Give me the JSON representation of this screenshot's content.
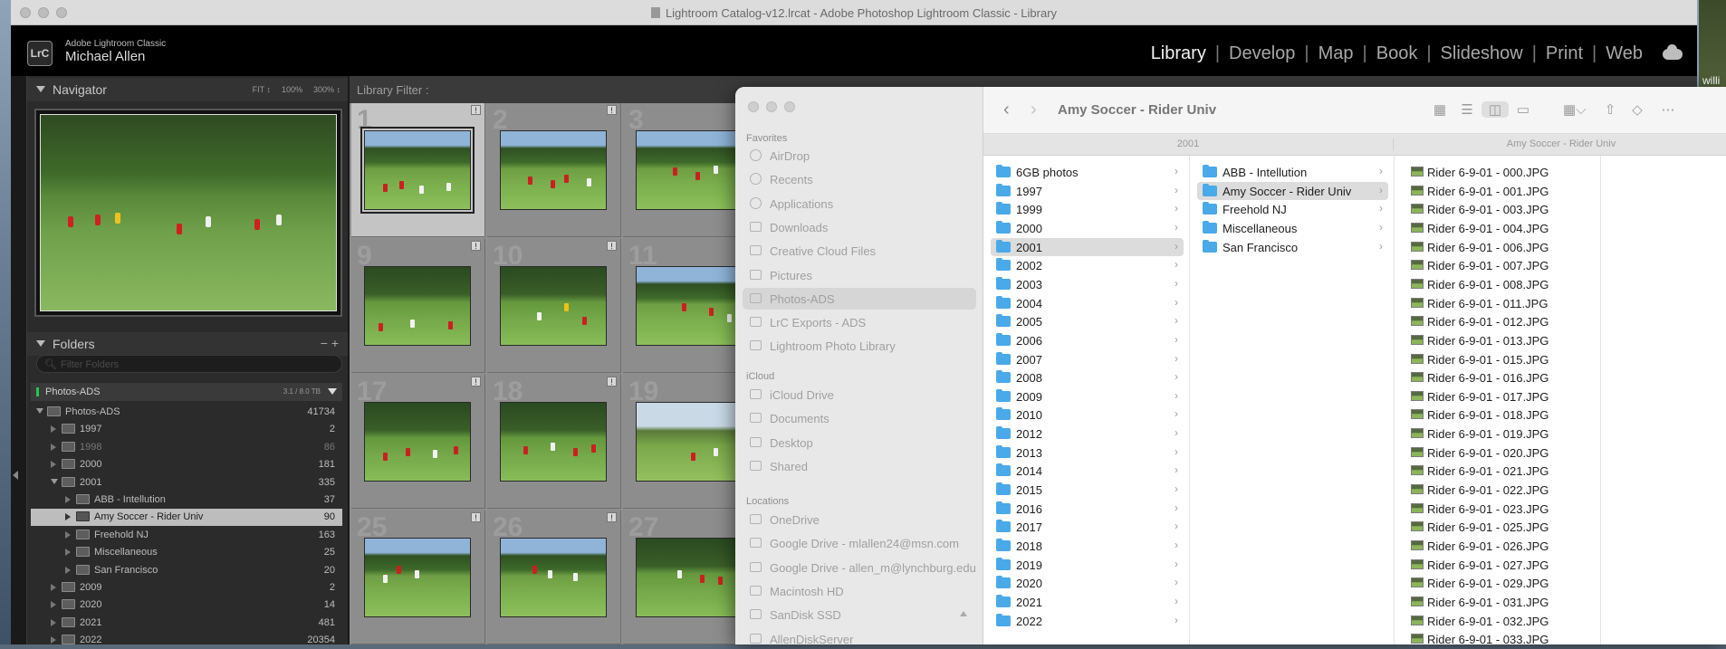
{
  "window_title": "Lightroom Catalog-v12.lrcat - Adobe Photoshop Lightroom Classic - Library",
  "identity": {
    "logo": "LrC",
    "app_name": "Adobe Lightroom Classic",
    "user": "Michael Allen"
  },
  "modules": [
    "Library",
    "Develop",
    "Map",
    "Book",
    "Slideshow",
    "Print",
    "Web"
  ],
  "active_module": "Library",
  "desktop_user_text": "willi",
  "navigator": {
    "title": "Navigator",
    "options": [
      "FIT ↕",
      "100%",
      "300% ↕"
    ]
  },
  "folders_panel": {
    "title": "Folders",
    "actions": "− +",
    "search_placeholder": "Filter Folders",
    "volume": {
      "name": "Photos-ADS",
      "size": "3.1 / 8.0 TB"
    },
    "rows": [
      {
        "name": "Photos-ADS",
        "count": "41734",
        "level": 0,
        "state": "open"
      },
      {
        "name": "1997",
        "count": "2",
        "level": 1,
        "state": "closed"
      },
      {
        "name": "1998",
        "count": "86",
        "level": 1,
        "state": "closed",
        "dim": true
      },
      {
        "name": "2000",
        "count": "181",
        "level": 1,
        "state": "closed"
      },
      {
        "name": "2001",
        "count": "335",
        "level": 1,
        "state": "open"
      },
      {
        "name": "ABB - Intellution",
        "count": "37",
        "level": 2,
        "state": "closed"
      },
      {
        "name": "Amy Soccer - Rider Univ",
        "count": "90",
        "level": 2,
        "state": "closed",
        "selected": true
      },
      {
        "name": "Freehold NJ",
        "count": "163",
        "level": 2,
        "state": "closed"
      },
      {
        "name": "Miscellaneous",
        "count": "25",
        "level": 2,
        "state": "closed"
      },
      {
        "name": "San Francisco",
        "count": "20",
        "level": 2,
        "state": "closed"
      },
      {
        "name": "2009",
        "count": "2",
        "level": 1,
        "state": "closed"
      },
      {
        "name": "2020",
        "count": "14",
        "level": 1,
        "state": "closed"
      },
      {
        "name": "2021",
        "count": "481",
        "level": 1,
        "state": "closed"
      },
      {
        "name": "2022",
        "count": "20354",
        "level": 1,
        "state": "closed"
      }
    ]
  },
  "library_filter": "Library Filter :",
  "grid": {
    "cells": [
      {
        "num": "1",
        "style": "sky",
        "selected": true
      },
      {
        "num": "2",
        "style": "sky"
      },
      {
        "num": "3",
        "style": "sky"
      },
      {
        "num": "9",
        "style": "woods"
      },
      {
        "num": "10",
        "style": "woods"
      },
      {
        "num": "11",
        "style": "sky"
      },
      {
        "num": "17",
        "style": "woods"
      },
      {
        "num": "18",
        "style": "woods"
      },
      {
        "num": "19",
        "style": "bright"
      },
      {
        "num": "25",
        "style": "sky"
      },
      {
        "num": "26",
        "style": "sky"
      },
      {
        "num": "27",
        "style": "woods"
      }
    ]
  },
  "finder": {
    "title": "Amy Soccer - Rider Univ",
    "col_headers": [
      "2001",
      "Amy Soccer - Rider Univ"
    ],
    "sidebar": {
      "favorites_label": "Favorites",
      "favorites": [
        "AirDrop",
        "Recents",
        "Applications",
        "Downloads",
        "Creative Cloud Files",
        "Pictures",
        "Photos-ADS",
        "LrC Exports - ADS",
        "Lightroom Photo Library"
      ],
      "selected": "Photos-ADS",
      "icloud_label": "iCloud",
      "icloud": [
        "iCloud Drive",
        "Documents",
        "Desktop",
        "Shared"
      ],
      "locations_label": "Locations",
      "locations": [
        "OneDrive",
        "Google Drive - mlallen24@msn.com",
        "Google Drive - allen_m@lynchburg.edu",
        "Macintosh HD",
        "SanDisk SSD",
        "AllenDiskServer"
      ]
    },
    "col1": [
      "6GB photos",
      "1997",
      "1999",
      "2000",
      "2001",
      "2002",
      "2003",
      "2004",
      "2005",
      "2006",
      "2007",
      "2008",
      "2009",
      "2010",
      "2012",
      "2013",
      "2014",
      "2015",
      "2016",
      "2017",
      "2018",
      "2019",
      "2020",
      "2021",
      "2022"
    ],
    "col1_selected": "2001",
    "col2": [
      "ABB - Intellution",
      "Amy Soccer - Rider Univ",
      "Freehold NJ",
      "Miscellaneous",
      "San Francisco"
    ],
    "col2_selected": "Amy Soccer - Rider Univ",
    "col3": [
      "Rider 6-9-01 - 000.JPG",
      "Rider 6-9-01 - 001.JPG",
      "Rider 6-9-01 - 003.JPG",
      "Rider 6-9-01 - 004.JPG",
      "Rider 6-9-01 - 006.JPG",
      "Rider 6-9-01 - 007.JPG",
      "Rider 6-9-01 - 008.JPG",
      "Rider 6-9-01 - 011.JPG",
      "Rider 6-9-01 - 012.JPG",
      "Rider 6-9-01 - 013.JPG",
      "Rider 6-9-01 - 015.JPG",
      "Rider 6-9-01 - 016.JPG",
      "Rider 6-9-01 - 017.JPG",
      "Rider 6-9-01 - 018.JPG",
      "Rider 6-9-01 - 019.JPG",
      "Rider 6-9-01 - 020.JPG",
      "Rider 6-9-01 - 021.JPG",
      "Rider 6-9-01 - 022.JPG",
      "Rider 6-9-01 - 023.JPG",
      "Rider 6-9-01 - 025.JPG",
      "Rider 6-9-01 - 026.JPG",
      "Rider 6-9-01 - 027.JPG",
      "Rider 6-9-01 - 029.JPG",
      "Rider 6-9-01 - 031.JPG",
      "Rider 6-9-01 - 032.JPG",
      "Rider 6-9-01 - 033.JPG"
    ]
  }
}
